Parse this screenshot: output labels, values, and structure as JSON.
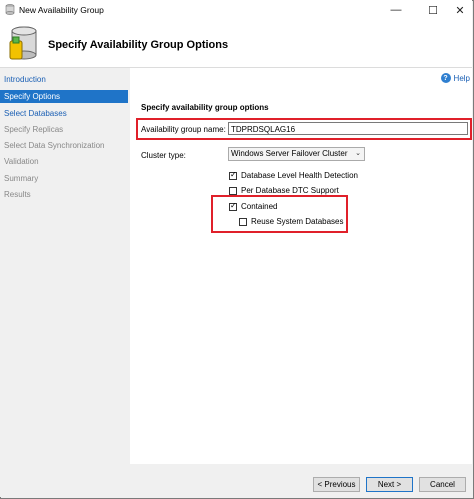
{
  "window": {
    "title": "New Availability Group",
    "minimize_icon": "minimize-icon",
    "maximize_icon": "maximize-icon",
    "close_icon": "close-icon"
  },
  "header": {
    "title": "Specify Availability Group Options",
    "icon": "database-wizard-icon"
  },
  "nav": [
    {
      "label": "Introduction",
      "state": "link"
    },
    {
      "label": "Specify Options",
      "state": "selected"
    },
    {
      "label": "Select Databases",
      "state": "link"
    },
    {
      "label": "Specify Replicas",
      "state": "disabled"
    },
    {
      "label": "Select Data Synchronization",
      "state": "disabled"
    },
    {
      "label": "Validation",
      "state": "disabled"
    },
    {
      "label": "Summary",
      "state": "disabled"
    },
    {
      "label": "Results",
      "state": "disabled"
    }
  ],
  "help": {
    "label": "Help",
    "icon": "help-icon"
  },
  "form": {
    "section_title": "Specify availability group options",
    "ag_name_label": "Availability group name:",
    "ag_name_value": "TDPRDSQLAG16",
    "cluster_type_label": "Cluster type:",
    "cluster_type_value": "Windows Server Failover Cluster",
    "options": {
      "db_health": {
        "label": "Database Level Health Detection",
        "checked": true
      },
      "dtc": {
        "label": "Per Database DTC Support",
        "checked": false
      },
      "contained": {
        "label": "Contained",
        "checked": true
      },
      "reuse": {
        "label": "Reuse System Databases",
        "checked": false
      }
    }
  },
  "buttons": {
    "previous": "< Previous",
    "next": "Next >",
    "cancel": "Cancel"
  },
  "colors": {
    "accent": "#1f74c8",
    "highlight": "#e0202a"
  }
}
